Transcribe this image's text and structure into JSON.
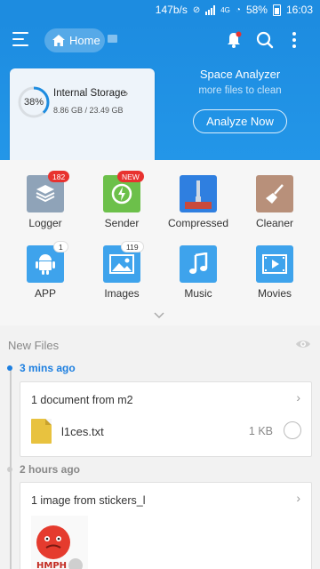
{
  "status_bar": {
    "speed": "147b/s",
    "battery": "58%",
    "time": "16:03",
    "network": "4G"
  },
  "toolbar": {
    "home_label": "Home",
    "icons": [
      "menu-icon",
      "home-icon",
      "chat-icon",
      "bell-icon",
      "search-icon",
      "more-vert-icon"
    ]
  },
  "storage": {
    "title": "Internal Storage",
    "used_percent": 38,
    "percent_label": "38%",
    "size_text": "8.86 GB / 23.49 GB"
  },
  "analyzer": {
    "title": "Space Analyzer",
    "subtitle": "more files to clean",
    "button_label": "Analyze Now"
  },
  "categories": [
    {
      "label": "Logger",
      "badge": "182",
      "icon": "logger-icon",
      "color": "#8fa3b8"
    },
    {
      "label": "Sender",
      "badge": "NEW",
      "icon": "sender-icon",
      "color": "#6cc04a"
    },
    {
      "label": "Compressed",
      "badge": "",
      "icon": "zip-icon",
      "color": "#2f7fe0"
    },
    {
      "label": "Cleaner",
      "badge": "",
      "icon": "broom-icon",
      "color": "#b8907a"
    },
    {
      "label": "APP",
      "badge": "1",
      "icon": "android-icon",
      "color": "#3ea3ec"
    },
    {
      "label": "Images",
      "badge": "119",
      "icon": "image-icon",
      "color": "#3ea3ec"
    },
    {
      "label": "Music",
      "badge": "",
      "icon": "music-icon",
      "color": "#3ea3ec"
    },
    {
      "label": "Movies",
      "badge": "",
      "icon": "movie-icon",
      "color": "#3ea3ec"
    }
  ],
  "new_files": {
    "title": "New Files",
    "groups": [
      {
        "time": "3 mins ago",
        "card_title": "1 document from m2",
        "file_name": "l1ces.txt",
        "file_size": "1 KB"
      },
      {
        "time": "2 hours ago",
        "card_title": "1 image from stickers_l",
        "thumb_text": "HMPH"
      }
    ]
  },
  "colors": {
    "primary": "#1d8ce0",
    "badge_red": "#e8322f",
    "recent_dot": "#1d7fe0"
  }
}
